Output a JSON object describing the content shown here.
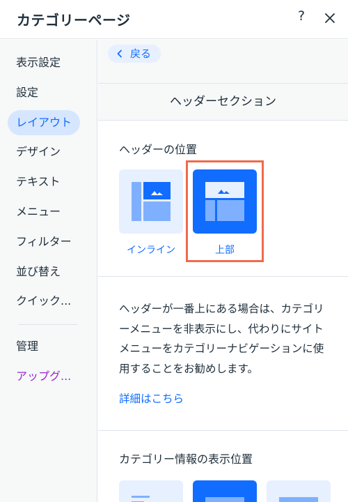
{
  "header": {
    "title": "カテゴリーページ",
    "help_label": "?"
  },
  "sidebar": {
    "items": [
      {
        "label": "表示設定"
      },
      {
        "label": "設定"
      },
      {
        "label": "レイアウト"
      },
      {
        "label": "デザイン"
      },
      {
        "label": "テキスト"
      },
      {
        "label": "メニュー"
      },
      {
        "label": "フィルター"
      },
      {
        "label": "並び替え"
      },
      {
        "label": "クイック..."
      },
      {
        "label": "管理"
      },
      {
        "label": "アップグ..."
      }
    ],
    "active_item": "レイアウト"
  },
  "main": {
    "back_label": "戻る",
    "section_title": "ヘッダーセクション",
    "header_position": {
      "label": "ヘッダーの位置",
      "options": [
        {
          "label": "インライン",
          "selected": false
        },
        {
          "label": "上部",
          "selected": true
        }
      ]
    },
    "description": "ヘッダーが一番上にある場合は、カテゴリーメニューを非表示にし、代わりにサイトメニューをカテゴリーナビゲーションに使用することをお勧めします。",
    "learn_more": "詳細はこちら",
    "category_info": {
      "label": "カテゴリー情報の表示位置",
      "selected_index": 1
    }
  },
  "colors": {
    "accent": "#116dff",
    "accent_light": "#e7f0ff",
    "highlight": "#f06a4b",
    "upgrade": "#9a27d5"
  }
}
